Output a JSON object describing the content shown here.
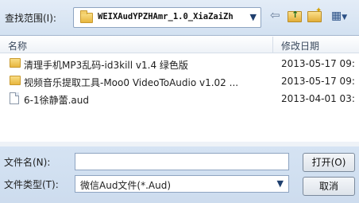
{
  "lookin": {
    "label": "查找范围(I):",
    "value": "WEIXAudYPZHAmr_1.0_XiaZaiZh"
  },
  "toolbar": {
    "back_icon": "back-arrow-icon",
    "up_icon": "up-folder-icon",
    "new_icon": "new-folder-icon",
    "view_icon": "view-menu-icon"
  },
  "list": {
    "columns": {
      "name": "名称",
      "date": "修改日期"
    },
    "rows": [
      {
        "type": "folder",
        "name": "清理手机MP3乱码-id3kill v1.4 绿色版",
        "date": "2013-05-17 09:"
      },
      {
        "type": "folder",
        "name": "视频音乐提取工具-Moo0 VideoToAudio v1.02 ...",
        "date": "2013-05-17 09:"
      },
      {
        "type": "file",
        "name": "6-1徐静蕾.aud",
        "date": "2013-04-01 03:"
      }
    ]
  },
  "filename": {
    "label": "文件名(N):",
    "value": ""
  },
  "filetype": {
    "label": "文件类型(T):",
    "value": "微信Aud文件(*.Aud)"
  },
  "buttons": {
    "open": "打开(O)",
    "cancel": "取消"
  }
}
